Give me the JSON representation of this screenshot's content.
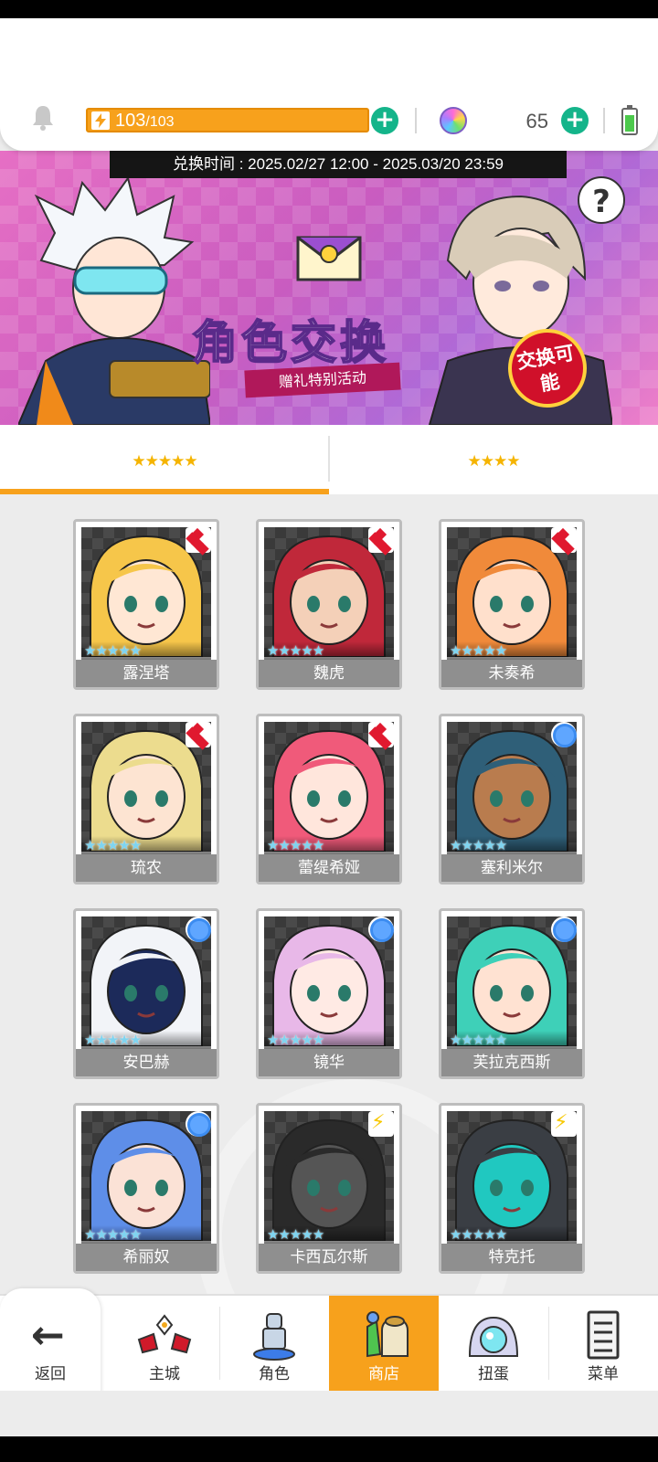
{
  "topbar": {
    "stamina_current": "103",
    "stamina_max": "/103",
    "gem_count": "65"
  },
  "banner": {
    "exchange_time": "兑换时间 : 2025.02/27 12:00 - 2025.03/20 23:59",
    "title": "角色交换",
    "subtitle": "赠礼特别活动",
    "badge": "交换可能",
    "help": "?"
  },
  "tabs": [
    {
      "label": "★★★★★",
      "active": true
    },
    {
      "label": "★★★★",
      "active": false
    }
  ],
  "characters": [
    {
      "name": "露涅塔",
      "stars": "★★★★★",
      "type": "diamond",
      "hair": "#f6c64a",
      "skin": "#ffe7d4"
    },
    {
      "name": "魏虎",
      "stars": "★★★★★",
      "type": "diamond",
      "hair": "#c0283a",
      "skin": "#f4d0b8"
    },
    {
      "name": "未奏希",
      "stars": "★★★★★",
      "type": "diamond",
      "hair": "#f08a3a",
      "skin": "#ffe0cc"
    },
    {
      "name": "琉农",
      "stars": "★★★★★",
      "type": "diamond",
      "hair": "#ecdc8e",
      "skin": "#fde4d2"
    },
    {
      "name": "蕾缇希娅",
      "stars": "★★★★★",
      "type": "diamond",
      "hair": "#f05a7a",
      "skin": "#ffe6dc"
    },
    {
      "name": "塞利米尔",
      "stars": "★★★★★",
      "type": "circle",
      "hair": "#2f5f78",
      "skin": "#b97c4e"
    },
    {
      "name": "安巴赫",
      "stars": "★★★★★",
      "type": "circle",
      "hair": "#f2f4f8",
      "skin": "#1c2a5a"
    },
    {
      "name": "镜华",
      "stars": "★★★★★",
      "type": "circle",
      "hair": "#e8b8e8",
      "skin": "#ffeae4"
    },
    {
      "name": "芙拉克西斯",
      "stars": "★★★★★",
      "type": "circle",
      "hair": "#3ed0b8",
      "skin": "#ffe2d2"
    },
    {
      "name": "希丽奴",
      "stars": "★★★★★",
      "type": "circle",
      "hair": "#5e8ee8",
      "skin": "#fbe2d6"
    },
    {
      "name": "卡西瓦尔斯",
      "stars": "★★★★★",
      "type": "bolt",
      "hair": "#2a2a2a",
      "skin": "#555"
    },
    {
      "name": "特克托",
      "stars": "★★★★★",
      "type": "bolt",
      "hair": "#3a3e44",
      "skin": "#20c8c0"
    }
  ],
  "nav": {
    "back": "返回",
    "items": [
      "主城",
      "角色",
      "商店",
      "扭蛋",
      "菜单"
    ],
    "active": "商店"
  },
  "colors": {
    "accent": "#f7a11c",
    "plus": "#14b48a",
    "name_bar": "#8f8f8f"
  }
}
